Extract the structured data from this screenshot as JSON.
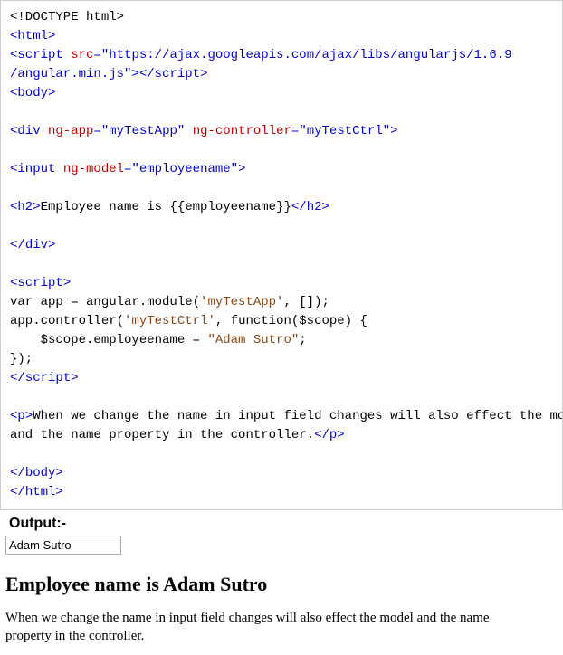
{
  "code": {
    "doctype": "<!DOCTYPE html>",
    "html_open": "html",
    "script_open": "script",
    "attr_src": "src",
    "src_val_line1": "\"https://ajax.googleapis.com/ajax/libs/angularjs/1.6.9",
    "src_val_line2": "/angular.min.js\"",
    "script_close_short": "></",
    "body_open": "body",
    "div_open": "div",
    "attr_ng_app": "ng-app",
    "ng_app_val": "\"myTestApp\"",
    "attr_ng_controller": "ng-controller",
    "ng_controller_val": "\"myTestCtrl\"",
    "input_open": "input",
    "attr_ng_model": "ng-model",
    "ng_model_val": "\"employeename\"",
    "h2_open": "h2",
    "h2_text": "Employee name is {{employeename}}",
    "h2_close": "h2",
    "div_close": "div",
    "js_l1": "var app = angular.module(",
    "js_s1": "'myTestApp'",
    "js_l1b": ", []);",
    "js_l2": "app.controller(",
    "js_s2": "'myTestCtrl'",
    "js_l2b": ", function($scope) {",
    "js_l3_indent": "    $scope.employeename = ",
    "js_s3": "\"Adam Sutro\"",
    "js_l3b": ";",
    "js_l4": "});",
    "script_close": "script",
    "p_open": "p",
    "p_text_l1": "When we change the name in input field changes will also effect the model",
    "p_text_l2": "and the name property in the controller.",
    "p_close": "p",
    "body_close": "body",
    "html_close": "html"
  },
  "output": {
    "label": "Output:-",
    "input_value": "Adam Sutro",
    "heading": "Employee name is Adam Sutro",
    "paragraph": "When we change the name in input field changes will also effect the model and the name property in the controller."
  }
}
